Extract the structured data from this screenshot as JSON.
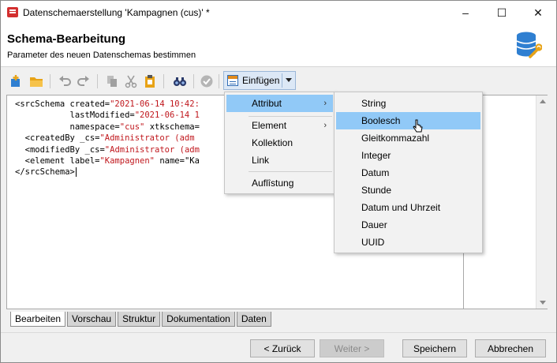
{
  "window": {
    "title": "Datenschemaerstellung 'Kampagnen (cus)' *",
    "controls": {
      "minimize": "–",
      "maximize": "☐",
      "close": "✕"
    }
  },
  "header": {
    "title": "Schema-Bearbeitung",
    "subtitle": "Parameter des neuen Datenschemas bestimmen",
    "icon": "database-wrench-icon"
  },
  "toolbar": {
    "insert_label": "Einfügen",
    "icons": [
      "new-schema-icon",
      "open-folder-icon",
      "undo-icon",
      "redo-icon",
      "copy-icon",
      "cut-icon",
      "paste-icon",
      "find-icon",
      "check-icon"
    ]
  },
  "editor": {
    "lines": [
      {
        "pre": "<srcSchema created=",
        "str": "\"2021-06-14 10:42:",
        "post": ""
      },
      {
        "pre": "           lastModified=",
        "str": "\"2021-06-14 1",
        "post": ""
      },
      {
        "pre": "           namespace=",
        "str": "\"cus\"",
        "post": " xtkschema="
      },
      {
        "pre": "  <createdBy _cs=",
        "str": "\"Administrator (adm",
        "post": ""
      },
      {
        "pre": "  <modifiedBy _cs=",
        "str": "\"Administrator (adm",
        "post": ""
      },
      {
        "pre": "  <element label=",
        "str": "\"Kampagnen\"",
        "post": " name=\"Ka"
      },
      {
        "pre": "</srcSchema>",
        "str": "",
        "post": ""
      }
    ],
    "right_fragments": [
      "\"",
      "",
      "\""
    ]
  },
  "tabs": [
    "Bearbeiten",
    "Vorschau",
    "Struktur",
    "Dokumentation",
    "Daten"
  ],
  "active_tab": "Bearbeiten",
  "buttons": {
    "back": "< Zurück",
    "next": "Weiter >",
    "save": "Speichern",
    "cancel": "Abbrechen"
  },
  "insert_menu": {
    "items": [
      "Attribut",
      "Element",
      "Kollektion",
      "Link",
      "Auflîstung"
    ],
    "highlighted": "Attribut"
  },
  "attribute_submenu": {
    "items": [
      "String",
      "Boolesch",
      "Gleitkommazahl",
      "Integer",
      "Datum",
      "Stunde",
      "Datum und Uhrzeit",
      "Dauer",
      "UUID"
    ],
    "highlighted": "Boolesch"
  },
  "colors": {
    "accent": "#91c9f7",
    "string": "#c0171d",
    "db_icon": "#2f7fd1",
    "wrench": "#e8a317"
  }
}
